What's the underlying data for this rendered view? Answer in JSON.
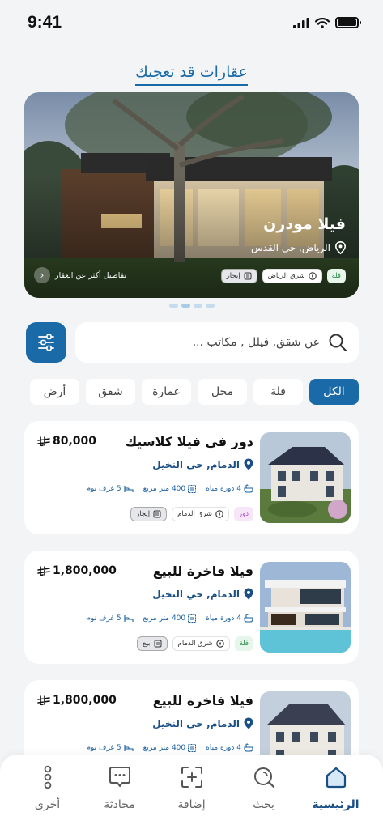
{
  "status_bar": {
    "time": "9:41"
  },
  "section_title": "عقارات قد تعجبك",
  "featured": {
    "title": "فيلا مودرن",
    "location": "الرياض, حي القدس",
    "tags": {
      "type": "فلة",
      "region": "شرق الرياض",
      "deal": "إيجار"
    },
    "details_link": "تفاصيل أكثر عن العقار",
    "carousel": {
      "total": 4,
      "active": 2
    }
  },
  "search": {
    "placeholder": "عن شقق, فيلل , مكاتب ..."
  },
  "categories": [
    "الكل",
    "فلة",
    "محل",
    "عمارة",
    "شقق",
    "أرض"
  ],
  "listings": [
    {
      "title": "دور في فيلا كلاسيك",
      "price": "80,000",
      "location": "الدمام, حي النخيل",
      "bathrooms": "4 دورة مياة",
      "area": "400 متر مربع",
      "bedrooms": "5 غرف نوم",
      "type_tag": "دور",
      "region_tag": "شرق الدمام",
      "deal_tag": "إيجار"
    },
    {
      "title": "فيلا فاخرة للبيع",
      "price": "1,800,000",
      "location": "الدمام, حي النخيل",
      "bathrooms": "4 دورة مياة",
      "area": "400 متر مربع",
      "bedrooms": "5 غرف نوم",
      "type_tag": "فلة",
      "region_tag": "شرق الدمام",
      "deal_tag": "بيع"
    },
    {
      "title": "فيلا فاخرة للبيع",
      "price": "1,800,000",
      "location": "الدمام, حي النخيل",
      "bathrooms": "4 دورة مياة",
      "area": "400 متر مربع",
      "bedrooms": "5 غرف نوم"
    }
  ],
  "nav": {
    "home": "الرئيسية",
    "search": "بحث",
    "add": "إضافة",
    "chat": "محادثة",
    "more": "أخرى"
  },
  "colors": {
    "primary": "#1a6aa8",
    "dark_blue": "#1a4f86",
    "background": "#f3f4f6"
  },
  "icons": [
    "signal-icon",
    "wifi-icon",
    "battery-icon",
    "location-pin-icon",
    "search-icon",
    "filter-icon",
    "bath-icon",
    "area-icon",
    "bed-icon",
    "home-icon",
    "chat-icon",
    "add-icon",
    "more-icon",
    "riyal-icon",
    "chevron-left-icon"
  ]
}
